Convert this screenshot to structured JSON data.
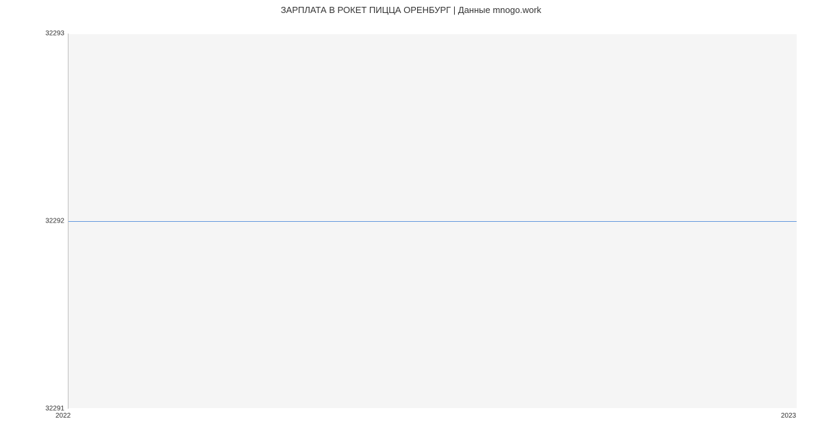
{
  "chart_data": {
    "type": "line",
    "title": "ЗАРПЛАТА В  РОКЕТ ПИЦЦА ОРЕНБУРГ | Данные mnogo.work",
    "x": [
      2022,
      2023
    ],
    "values": [
      32292,
      32292
    ],
    "xlabel": "",
    "ylabel": "",
    "ylim": [
      32291,
      32293
    ],
    "xlim": [
      2022,
      2023
    ],
    "y_ticks": [
      32291,
      32292,
      32293
    ],
    "x_ticks": [
      2022,
      2023
    ],
    "line_color": "#6699dd",
    "grid": true
  }
}
